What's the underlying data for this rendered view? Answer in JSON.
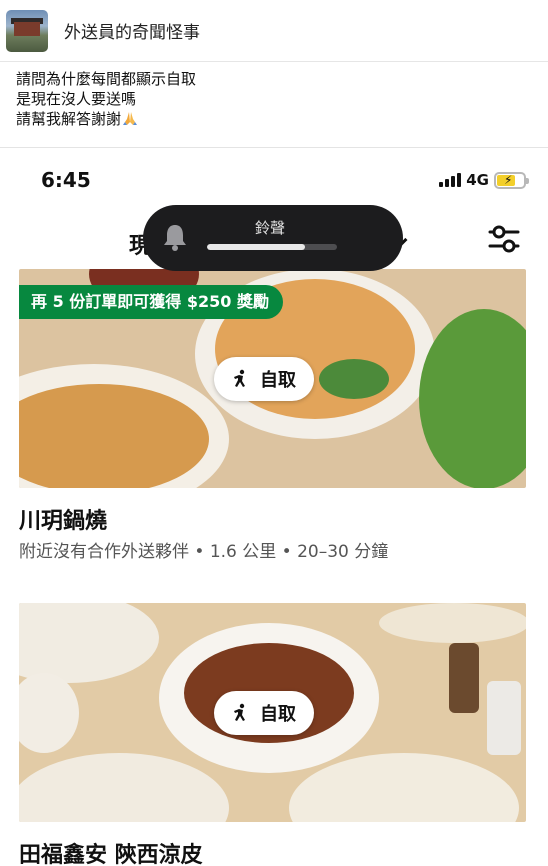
{
  "group": {
    "title": "外送員的奇聞怪事"
  },
  "post": {
    "lines": [
      "請問為什麼每間都顯示自取",
      "是現在沒人要送嗎",
      "請幫我解答謝謝"
    ],
    "emoji_icon": "pray-icon"
  },
  "phone": {
    "status": {
      "time": "6:45",
      "network": "4G",
      "battery_fill": 0.7,
      "signal_bars": 4
    },
    "nav": {
      "title_partial": "現",
      "filter_icon": "filter-icon"
    },
    "ringer": {
      "label": "鈴聲",
      "level": 0.75,
      "icon": "bell-icon"
    },
    "restaurants": [
      {
        "promo": "再 5 份訂單即可獲得 $250 獎勵",
        "mode": "自取",
        "name": "川玥鍋燒",
        "meta": "附近沒有合作外送夥伴 • 1.6 公里 • 20–30 分鐘"
      },
      {
        "mode": "自取",
        "name": "田福鑫安 陝西涼皮"
      }
    ]
  },
  "colors": {
    "promo_green": "#07883f",
    "ringer_bg": "#1c1c1e",
    "battery_yellow": "#f3cf2a"
  }
}
